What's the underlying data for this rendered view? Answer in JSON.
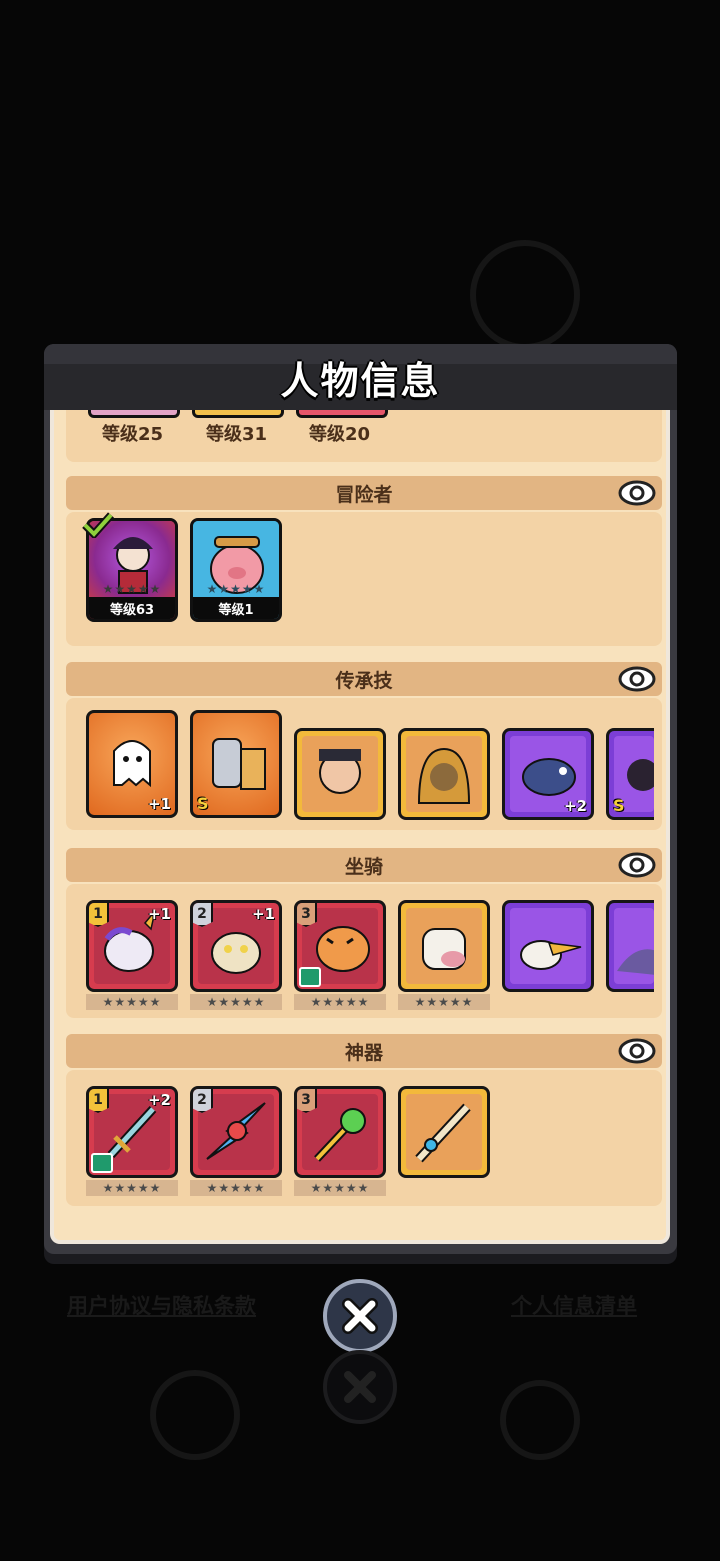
{
  "modal": {
    "title": "人物信息"
  },
  "pets": {
    "levels": [
      "等级25",
      "等级31",
      "等级20"
    ]
  },
  "adventurers": {
    "label": "冒险者",
    "items": [
      {
        "level": "等级63",
        "selected": true
      },
      {
        "level": "等级1",
        "selected": false
      }
    ]
  },
  "legacy_skills": {
    "label": "传承技",
    "badges": {
      "plus_one": "+1",
      "s": "S",
      "plus_two": "+2"
    }
  },
  "mounts": {
    "label": "坐骑",
    "ranks": [
      "1",
      "2",
      "3"
    ],
    "plus": "+1"
  },
  "artifacts": {
    "label": "神器",
    "ranks": [
      "1",
      "2",
      "3"
    ],
    "plus": "+2"
  },
  "stars": "★★★★★",
  "footer": {
    "user_agreement": "用户协议与隐私条款",
    "personal_info": "个人信息清单"
  },
  "colors": {
    "paper": "#f8e2bd",
    "section_head": "#e2b583",
    "header": "#28282c"
  }
}
